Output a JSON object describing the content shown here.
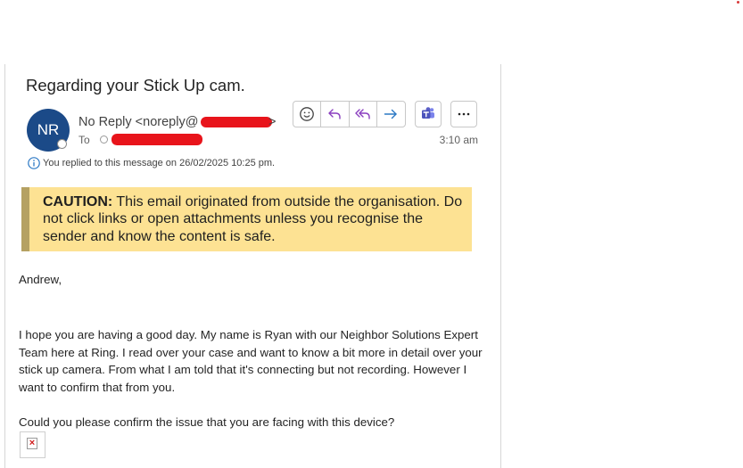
{
  "email": {
    "subject": "Regarding your Stick Up cam.",
    "sender_display": "No Reply <noreply@",
    "sender_close": ">",
    "avatar_initials": "NR",
    "to_label": "To",
    "time": "3:10 am",
    "replied_note": "You replied to this message on 26/02/2025 10:25 pm."
  },
  "actions": {
    "emoji_icon": "emoji-reaction-icon",
    "reply_icon": "reply-icon",
    "reply_all_icon": "reply-all-icon",
    "forward_icon": "forward-icon",
    "teams_icon": "teams-icon",
    "more_icon": "more-options-icon"
  },
  "caution": {
    "label": "CAUTION:",
    "text": " This email originated from outside the organisation. Do not click links or open attachments unless you recognise the sender and know the content is safe."
  },
  "body": {
    "greeting": "Andrew,",
    "paragraph1": "I hope you are having a good day. My name is Ryan with our Neighbor Solutions Expert Team here at Ring. I read over your case and want to know a bit more in detail over your stick up camera. From what I am told that it's connecting but not recording. However I want to confirm that from you.",
    "paragraph2": "Could you please confirm the issue that you are facing with this device?"
  },
  "colors": {
    "avatar": "#1b4a88",
    "caution_background": "#fde293",
    "caution_border": "#b5a162",
    "redaction": "#e8141b",
    "action_reply": "#8a3fbf",
    "action_forward": "#2b78c4",
    "teams": "#5b5fc7"
  }
}
